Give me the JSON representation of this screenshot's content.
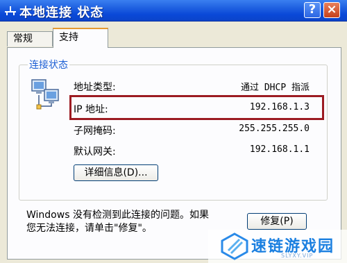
{
  "window": {
    "title": "本地连接 状态",
    "help_label": "?",
    "close_label": "×"
  },
  "tabs": [
    {
      "label": "常规"
    },
    {
      "label": "支持"
    }
  ],
  "connection_status": {
    "group_title": "连接状态",
    "rows": [
      {
        "label": "地址类型:",
        "value": "通过 DHCP 指派"
      },
      {
        "label": "IP 地址:",
        "value": "192.168.1.3"
      },
      {
        "label": "子网掩码:",
        "value": "255.255.255.0"
      },
      {
        "label": "默认网关:",
        "value": "192.168.1.1"
      }
    ],
    "details_button": "详细信息(D)..."
  },
  "footer": {
    "message_line1": "Windows 没有检测到此连接的问题。如果",
    "message_line2": "您无法连接，请单击\"修复\"。",
    "repair_button": "修复(P)"
  },
  "watermark": {
    "text": "速链游戏园",
    "subtext": "SLYXY.VIP"
  },
  "colors": {
    "titlebar": "#0a48d8",
    "highlight_border": "#9c1b22",
    "group_label": "#1c5fd4",
    "watermark": "#1a7fe0"
  }
}
